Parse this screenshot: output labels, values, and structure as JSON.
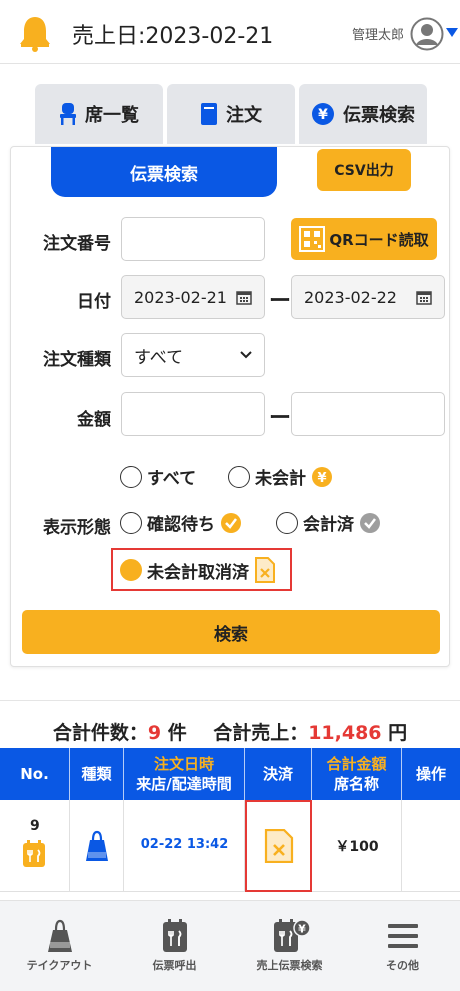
{
  "header": {
    "sales_date": "売上日:2023-02-21",
    "user_name": "管理太郎"
  },
  "tabs": [
    {
      "label": "席一覧",
      "icon": "chair-icon"
    },
    {
      "label": "注文",
      "icon": "book-icon"
    },
    {
      "label": "伝票検索",
      "icon": "yen-icon"
    }
  ],
  "search_panel": {
    "title": "伝票検索",
    "csv_button": "CSV出力",
    "order_number_label": "注文番号",
    "order_number_value": "",
    "qr_button": "QRコード読取",
    "date_label": "日付",
    "date_from": "2023-02-21",
    "date_to": "2023-02-22",
    "order_type_label": "注文種類",
    "order_type_value": "すべて",
    "amount_label": "金額",
    "amount_from": "",
    "amount_to": "",
    "range_separator": "ー",
    "display_label": "表示形態",
    "options": {
      "all": "すべて",
      "unpaid": "未会計",
      "pending": "確認待ち",
      "paid": "会計済",
      "cancelled": "未会計取消済"
    },
    "selected_option": "未会計取消済",
    "search_button": "検索"
  },
  "summary": {
    "count_label": "合計件数：",
    "count_value": "9",
    "count_unit": "件",
    "sales_label": "合計売上：",
    "sales_value": "11,486",
    "sales_unit": "円"
  },
  "table": {
    "headers": {
      "no": "No.",
      "type": "種類",
      "order_time_top": "注文日時",
      "order_time_bottom": "来店/配達時間",
      "payment": "決済",
      "amount_top": "合計金額",
      "amount_bottom": "席名称",
      "action": "操作"
    },
    "rows": [
      {
        "no": "9",
        "datetime": "02-22 13:42",
        "amount": "￥100"
      }
    ]
  },
  "bottom_nav": [
    {
      "label": "テイクアウト",
      "icon": "takeout-bag-icon"
    },
    {
      "label": "伝票呼出",
      "icon": "slip-icon"
    },
    {
      "label": "売上伝票検索",
      "icon": "sales-slip-search-icon"
    },
    {
      "label": "その他",
      "icon": "menu-icon"
    }
  ],
  "colors": {
    "primary_blue": "#0a58e4",
    "accent_orange": "#f8b01f",
    "highlight_red": "#e53935"
  }
}
